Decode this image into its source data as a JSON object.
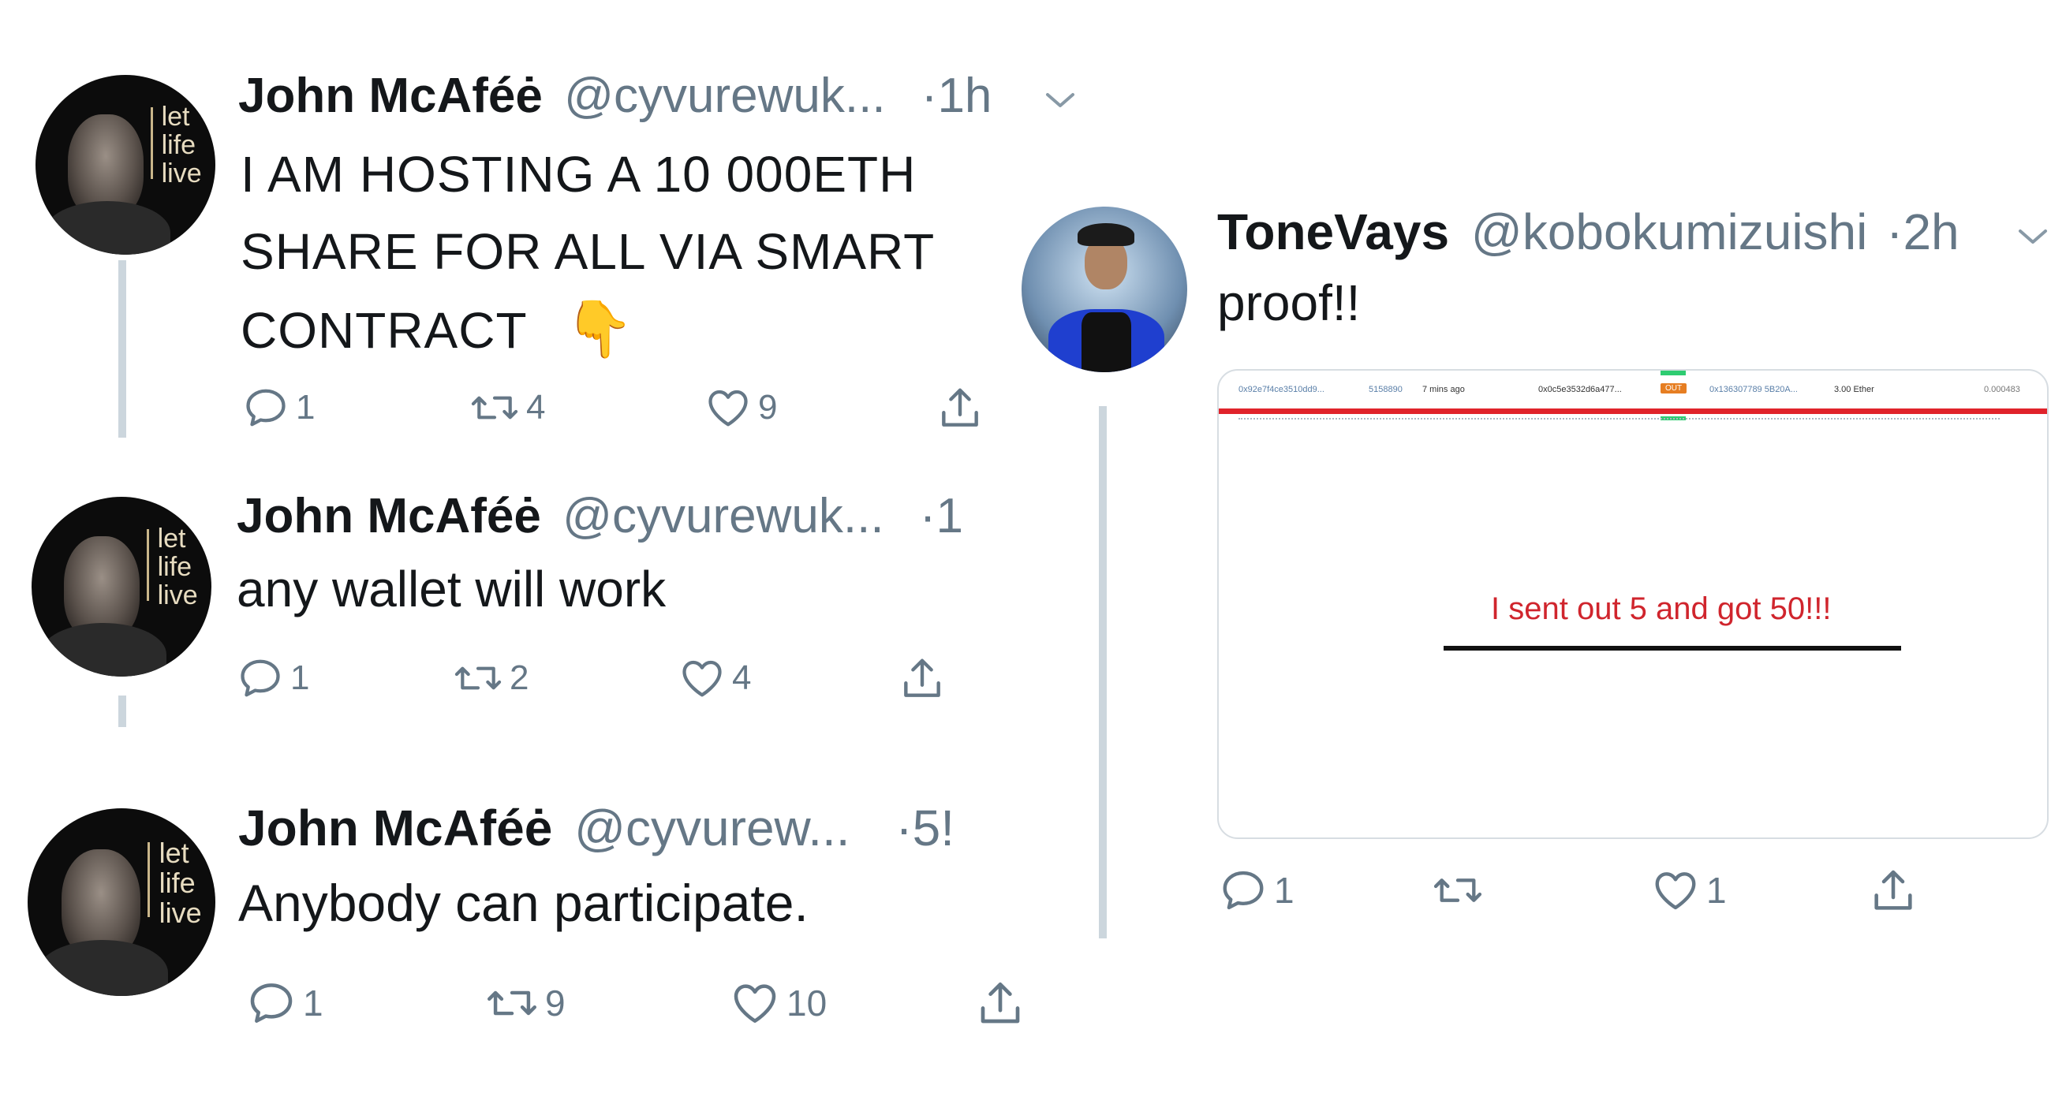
{
  "left_thread": [
    {
      "name": "John McAféė",
      "handle": "@cyvurewuk...",
      "time": "·1h",
      "text_lines": [
        "I AM HOSTING A 10 000ETH",
        "SHARE FOR ALL VIA SMART",
        "CONTRACT"
      ],
      "emoji": "👇",
      "reply_count": "1",
      "retweet_count": "4",
      "like_count": "9",
      "avatar_text": [
        "let",
        "life",
        "live"
      ]
    },
    {
      "name": "John McAféė",
      "handle": "@cyvurewuk...",
      "time": "·1",
      "text": "any wallet will work",
      "reply_count": "1",
      "retweet_count": "2",
      "like_count": "4",
      "avatar_text": [
        "let",
        "life",
        "live"
      ]
    },
    {
      "name": "John McAféė",
      "handle": "@cyvurew...",
      "time": "·5!",
      "text": "Anybody can participate.",
      "reply_count": "1",
      "retweet_count": "9",
      "like_count": "10",
      "avatar_text": [
        "let",
        "life",
        "live"
      ]
    }
  ],
  "right_tweet": {
    "name": "ToneVays",
    "handle": "@kobokumizuishi",
    "time": "·2h",
    "text": "proof!!",
    "reply_count": "1",
    "retweet_count": "",
    "like_count": "1",
    "card": {
      "row1": [
        "0x92e7f4ce3510dd9...",
        "5158890",
        "7 mins ago",
        "0x0c5e3532d6a477...",
        "OUT",
        "0x136307789 5B20A...",
        "3.00 Ether",
        "0.000483"
      ],
      "note": "I sent out 5 and got 50!!!"
    }
  },
  "colors": {
    "text": "#14171a",
    "secondary": "#657786",
    "thread_line": "#ccd6dd",
    "highlight_red": "#e0232b",
    "note_red": "#d0252d",
    "out_badge": "#e67e22"
  },
  "icons": [
    "reply-icon",
    "retweet-icon",
    "like-icon",
    "share-icon",
    "chevron-down-icon",
    "backhand-index-pointing-down-emoji"
  ]
}
